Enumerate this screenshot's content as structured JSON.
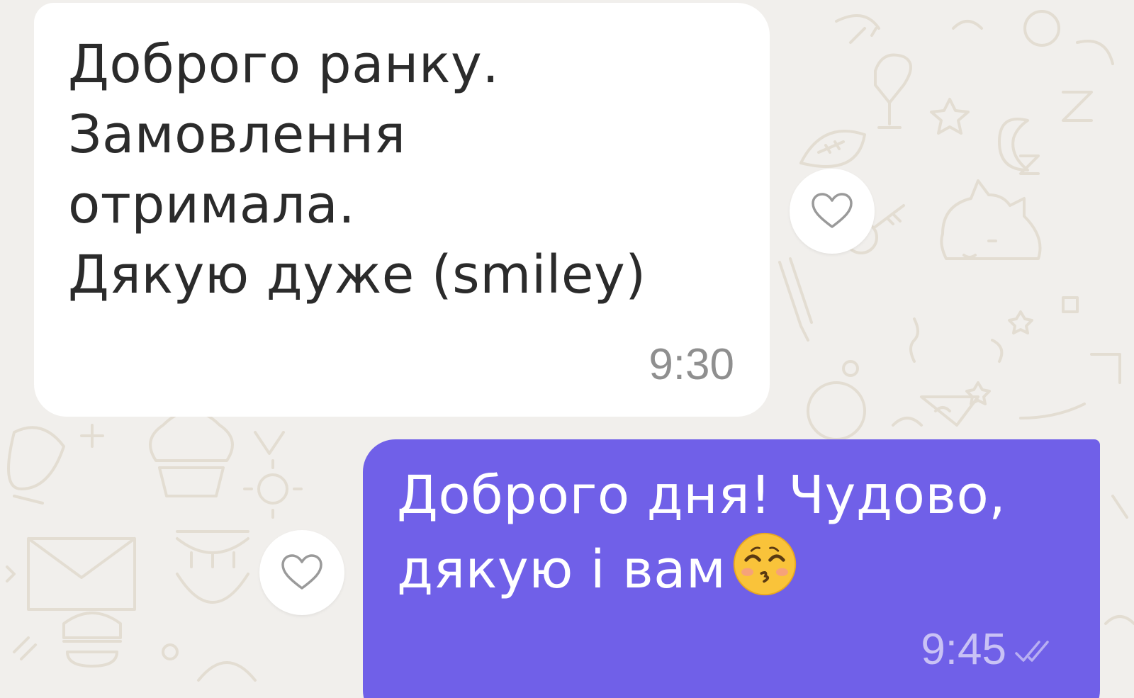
{
  "colors": {
    "background": "#f1efec",
    "incoming_bubble": "#ffffff",
    "outgoing_bubble": "#7060e8",
    "incoming_text": "#2b2b2b",
    "outgoing_text": "#ffffff",
    "incoming_time": "#8f8f8f",
    "outgoing_time": "#c9c2f5"
  },
  "messages": [
    {
      "direction": "incoming",
      "text": "Доброго ранку.\nЗамовлення\nотримала.\nДякую дуже (smiley)",
      "time": "9:30",
      "reaction_icon": "heart-outline-icon"
    },
    {
      "direction": "outgoing",
      "text": "Доброго дня! Чудово,\nдякую і вам",
      "emoji": "kissing-face-with-smiling-eyes",
      "time": "9:45",
      "status_icon": "double-check-icon",
      "reaction_icon": "heart-outline-icon"
    }
  ]
}
